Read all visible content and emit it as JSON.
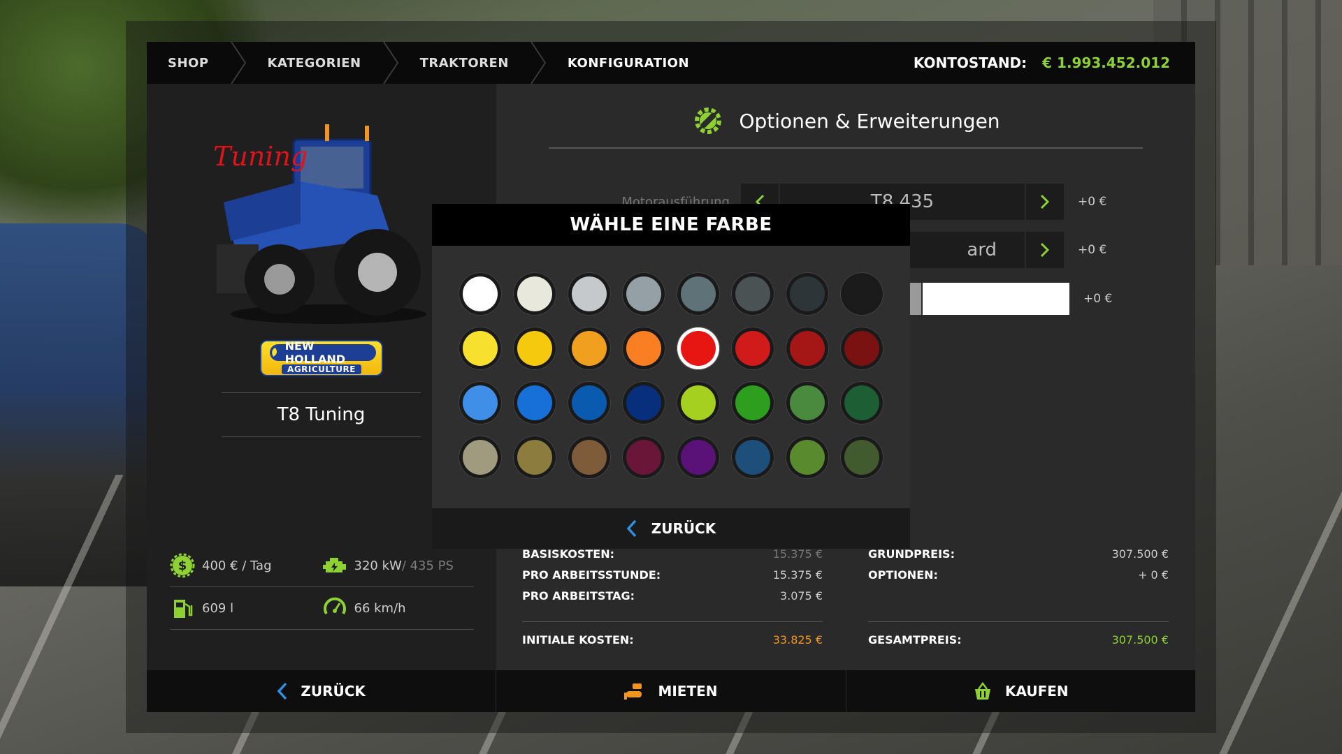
{
  "breadcrumbs": [
    "SHOP",
    "KATEGORIEN",
    "TRAKTOREN",
    "KONFIGURATION"
  ],
  "balance": {
    "label": "KONTOSTAND:",
    "amount": "€ 1.993.452.012"
  },
  "vehicle": {
    "badge": "Tuning",
    "brand_top": "NEW HOLLAND",
    "brand_bottom": "AGRICULTURE",
    "name": "T8 Tuning"
  },
  "stats": {
    "cost_per_day": "400 € / Tag",
    "power_kw": "320 kW",
    "power_ps": " / 435 PS",
    "fuel": "609 l",
    "speed": "66 km/h"
  },
  "options": {
    "title": "Optionen & Erweiterungen",
    "rows": [
      {
        "label": "Motorausführung",
        "value": "T8 435",
        "price": "+0 €"
      },
      {
        "label": "",
        "value": "ard",
        "price": "+0 €"
      },
      {
        "label": "",
        "value": "",
        "price": "+0 €"
      }
    ]
  },
  "color_picker": {
    "title": "WÄHLE EINE FARBE",
    "back_label": "ZURÜCK",
    "selected_index": 12,
    "colors": [
      "#ffffff",
      "#e8e8dc",
      "#c5c9cb",
      "#94a0a6",
      "#5e7278",
      "#4b5254",
      "#2e3538",
      "#1b1b1b",
      "#f8e02e",
      "#f5c90d",
      "#f0a01e",
      "#fa7f23",
      "#e81613",
      "#d11b1b",
      "#a51616",
      "#7a1212",
      "#3f8fe8",
      "#1770d8",
      "#0a5ab0",
      "#072f7c",
      "#a6d020",
      "#2e9e1e",
      "#4a8a3e",
      "#1d5e34",
      "#a09a7e",
      "#8c7d3e",
      "#7e5c3a",
      "#6a1638",
      "#5a1278",
      "#1e4f7a",
      "#5a8a2e",
      "#415a2e"
    ]
  },
  "costs": {
    "left": [
      {
        "label": "BASISKOSTEN:",
        "value": "15.375 €"
      },
      {
        "label": "PRO ARBEITSSTUNDE:",
        "value": "15.375 €"
      },
      {
        "label": "PRO ARBEITSTAG:",
        "value": "3.075 €"
      }
    ],
    "left_total": {
      "label": "INITIALE KOSTEN:",
      "value": "33.825 €"
    },
    "right": [
      {
        "label": "GRUNDPREIS:",
        "value": "307.500 €"
      },
      {
        "label": "OPTIONEN:",
        "value": "+ 0 €"
      }
    ],
    "right_total": {
      "label": "GESAMTPREIS:",
      "value": "307.500 €"
    }
  },
  "bottom": {
    "back": "ZURÜCK",
    "rent": "MIETEN",
    "buy": "KAUFEN"
  },
  "colors": {
    "accent_green": "#8dd132",
    "accent_orange": "#f2951f",
    "accent_blue": "#2f8fe0"
  }
}
